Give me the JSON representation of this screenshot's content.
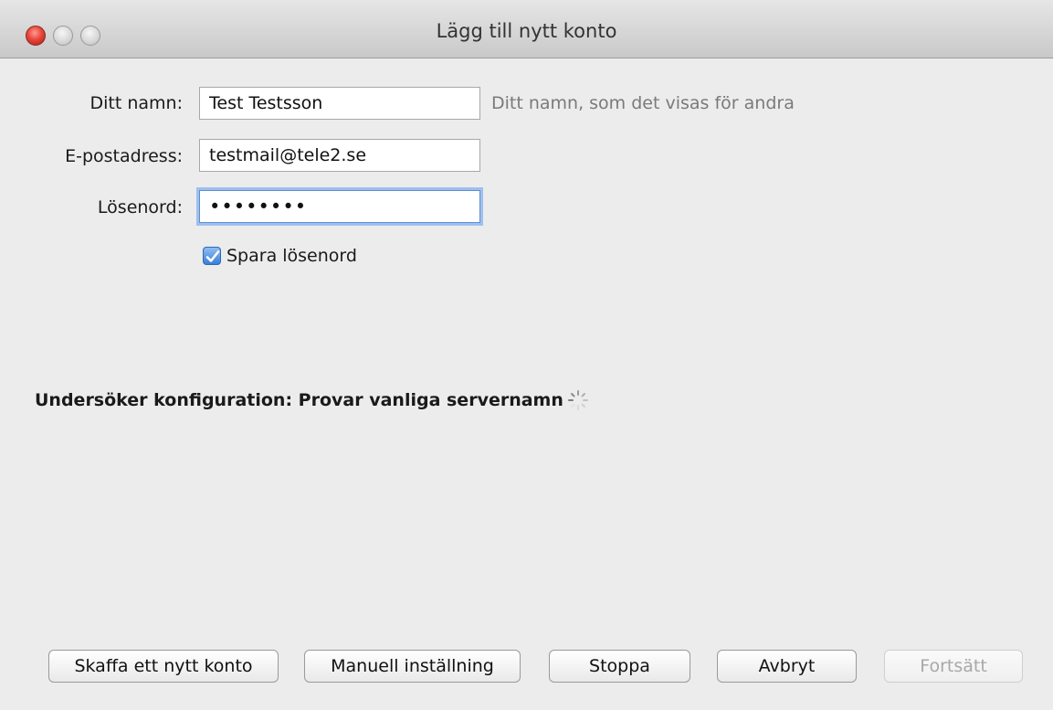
{
  "window": {
    "title": "Lägg till nytt konto"
  },
  "form": {
    "name_label": "Ditt namn:",
    "name_value": "Test Testsson",
    "name_hint": "Ditt namn, som det visas för andra",
    "email_label": "E-postadress:",
    "email_value": "testmail@tele2.se",
    "password_label": "Lösenord:",
    "password_value": "••••••••",
    "save_password_label": "Spara lösenord",
    "save_password_checked": true
  },
  "status": {
    "text": "Undersöker konfiguration: Provar vanliga servernamn",
    "spinner_icon": "spinner-icon"
  },
  "buttons": {
    "get_new_account": "Skaffa ett nytt konto",
    "manual_setup": "Manuell inställning",
    "stop": "Stoppa",
    "cancel": "Avbryt",
    "continue": "Fortsätt"
  }
}
